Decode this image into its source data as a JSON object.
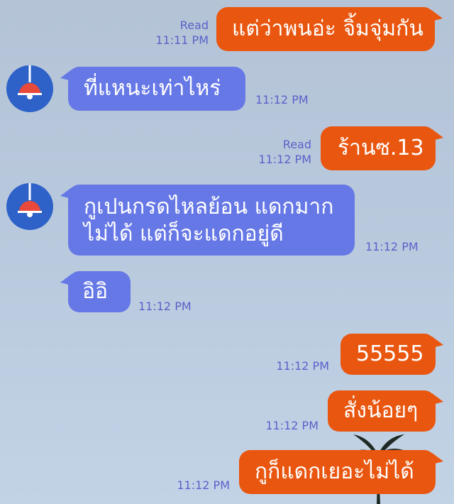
{
  "messages": [
    {
      "side": "out",
      "text": "แต่ว่าพนอ่ะ จิ้มจุ่มกัน",
      "read": "Read",
      "time": "11:11 PM"
    },
    {
      "side": "in",
      "text": "ที่แหนะเท่าไหร่",
      "time": "11:12 PM"
    },
    {
      "side": "out",
      "text": "ร้านซ.13",
      "read": "Read",
      "time": "11:12 PM"
    },
    {
      "side": "in",
      "text_line1": "กูเปนกรดไหลย้อน แดกมาก",
      "text_line2": "ไม่ได้ แต่ก็จะแดกอยู่ดี",
      "time": "11:12 PM"
    },
    {
      "side": "in",
      "text": "อิอิ",
      "time": "11:12 PM"
    },
    {
      "side": "out",
      "text": "55555",
      "time": "11:12 PM"
    },
    {
      "side": "out",
      "text": "สั่งน้อยๆ",
      "time": "11:12 PM"
    },
    {
      "side": "out",
      "text": "กูก็แดกเยอะไม่ได้",
      "time": "11:12 PM"
    }
  ],
  "colors": {
    "outgoing_bubble": "#e9560f",
    "incoming_bubble": "#6678e6",
    "meta_text": "#5a62c9",
    "avatar_bg": "#2e62c9",
    "lamp": "#e8493a"
  },
  "icons": {
    "avatar": "pendant-lamp-icon"
  }
}
